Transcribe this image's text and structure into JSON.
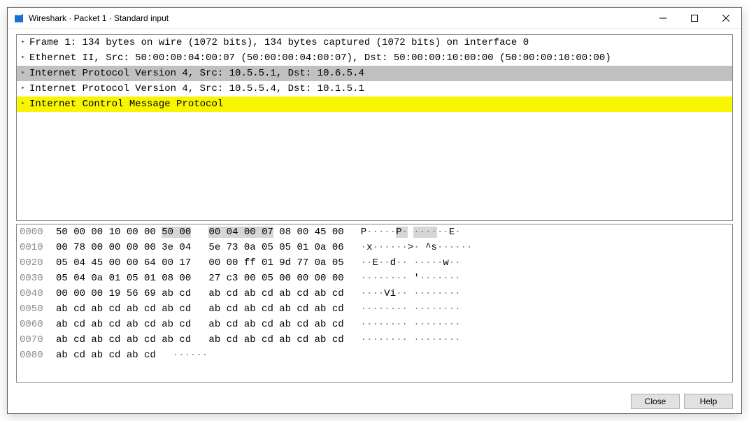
{
  "window": {
    "title": "Wireshark · Packet 1 · Standard input"
  },
  "tree": {
    "items": [
      {
        "label": "Frame 1: 134 bytes on wire (1072 bits), 134 bytes captured (1072 bits) on interface 0",
        "selected": false,
        "highlight": false
      },
      {
        "label": "Ethernet II, Src: 50:00:00:04:00:07 (50:00:00:04:00:07), Dst: 50:00:00:10:00:00 (50:00:00:10:00:00)",
        "selected": false,
        "highlight": false
      },
      {
        "label": "Internet Protocol Version 4, Src: 10.5.5.1, Dst: 10.6.5.4",
        "selected": true,
        "highlight": false
      },
      {
        "label": "Internet Protocol Version 4, Src: 10.5.5.4, Dst: 10.1.5.1",
        "selected": false,
        "highlight": false
      },
      {
        "label": "Internet Control Message Protocol",
        "selected": false,
        "highlight": true
      }
    ]
  },
  "hex": {
    "rows": [
      {
        "offset": "0000",
        "b1": "50 00 00 10 00 00 ",
        "b1hl": "50 00",
        "b2pre": "   ",
        "b2hl": "00 04 00 07",
        "b2post": " 08 00 45 00",
        "a1": "P",
        "a1d": "·····",
        "a1hl": "P·",
        "a2pre": " ",
        "a2hl": "····",
        "a2post": "··E·"
      },
      {
        "offset": "0010",
        "bytes": "00 78 00 00 00 00 3e 04   5e 73 0a 05 05 01 0a 06",
        "ascii_parts": [
          "·",
          "x",
          "······",
          ">",
          "·",
          " ",
          "^",
          "s",
          "······"
        ]
      },
      {
        "offset": "0020",
        "bytes": "05 04 45 00 00 64 00 17   00 00 ff 01 9d 77 0a 05",
        "ascii_parts": [
          "··",
          "E",
          "··",
          "d",
          "··",
          " ",
          "·····",
          "w",
          "··"
        ]
      },
      {
        "offset": "0030",
        "bytes": "05 04 0a 01 05 01 08 00   27 c3 00 05 00 00 00 00",
        "ascii_parts": [
          "········",
          " ",
          "'",
          "·······"
        ]
      },
      {
        "offset": "0040",
        "bytes": "00 00 00 19 56 69 ab cd   ab cd ab cd ab cd ab cd",
        "ascii_parts": [
          "····",
          "Vi",
          "··",
          " ",
          "········"
        ]
      },
      {
        "offset": "0050",
        "bytes": "ab cd ab cd ab cd ab cd   ab cd ab cd ab cd ab cd",
        "ascii_parts": [
          "········",
          " ",
          "········"
        ]
      },
      {
        "offset": "0060",
        "bytes": "ab cd ab cd ab cd ab cd   ab cd ab cd ab cd ab cd",
        "ascii_parts": [
          "········",
          " ",
          "········"
        ]
      },
      {
        "offset": "0070",
        "bytes": "ab cd ab cd ab cd ab cd   ab cd ab cd ab cd ab cd",
        "ascii_parts": [
          "········",
          " ",
          "········"
        ]
      },
      {
        "offset": "0080",
        "bytes": "ab cd ab cd ab cd",
        "ascii_parts": [
          "······"
        ]
      }
    ]
  },
  "footer": {
    "close_label": "Close",
    "help_label": "Help"
  }
}
